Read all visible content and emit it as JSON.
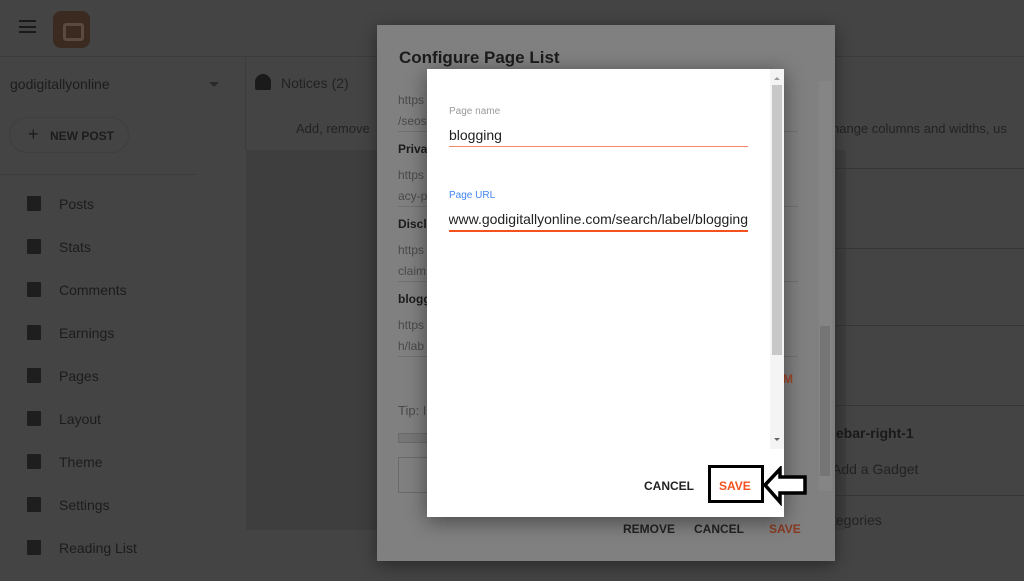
{
  "topbar": {
    "menu_icon": "hamburger-icon",
    "logo": "blogger-logo"
  },
  "sidebar": {
    "blog_name": "godigitallyonline",
    "new_post": "NEW POST",
    "items": [
      {
        "label": "Posts",
        "icon": "posts-icon"
      },
      {
        "label": "Stats",
        "icon": "stats-icon"
      },
      {
        "label": "Comments",
        "icon": "comments-icon"
      },
      {
        "label": "Earnings",
        "icon": "dollar-icon"
      },
      {
        "label": "Pages",
        "icon": "pages-icon"
      },
      {
        "label": "Layout",
        "icon": "layout-icon"
      },
      {
        "label": "Theme",
        "icon": "paint-roller-icon"
      },
      {
        "label": "Settings",
        "icon": "gear-icon"
      },
      {
        "label": "Reading List",
        "icon": "bookmark-icon"
      }
    ]
  },
  "main": {
    "notices": "Notices (2)",
    "add_remove": "Add, remove",
    "change_cols": "hange columns and widths, us",
    "right_items": [
      "lebar-right-1",
      "Add a Gadget",
      "tegories"
    ]
  },
  "outer_dialog": {
    "title": "Configure Page List",
    "rows": [
      {
        "text": "https",
        "bold": false
      },
      {
        "text": "/seos",
        "bold": false
      },
      {
        "text": "Priva",
        "bold": true
      },
      {
        "text": "https",
        "bold": false
      },
      {
        "text": "acy-p",
        "bold": false
      },
      {
        "text": "Discl",
        "bold": true
      },
      {
        "text": "https",
        "bold": false
      },
      {
        "text": "claim",
        "bold": false
      },
      {
        "text": "blogg",
        "bold": true
      },
      {
        "text": "https",
        "bold": false
      },
      {
        "text": "h/lab",
        "bold": false
      }
    ],
    "add_partial": "M",
    "tip": "Tip: I",
    "remove": "REMOVE",
    "cancel": "CANCEL",
    "save": "SAVE"
  },
  "inner_dialog": {
    "page_name_label": "Page name",
    "page_name_value": "blogging",
    "page_url_label": "Page URL",
    "page_url_value": "https://www.godigitallyonline.com/search/label/blogging",
    "cancel": "CANCEL",
    "save": "SAVE"
  },
  "colors": {
    "accent": "#f4511e",
    "label_focus": "#4285f4"
  }
}
